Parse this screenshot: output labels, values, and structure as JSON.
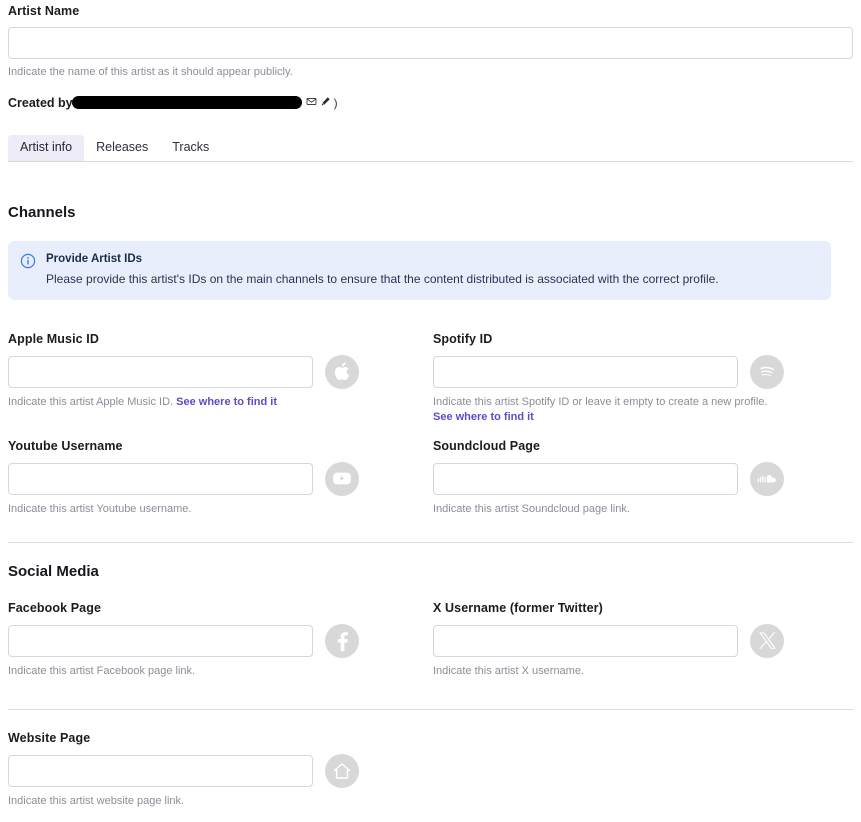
{
  "artist_name": {
    "label": "Artist Name",
    "value": "",
    "placeholder": "",
    "help": "Indicate the name of this artist as it should appear publicly."
  },
  "created_by": {
    "label": "Created by",
    "redacted_value": "",
    "mail_icon": "mail-icon",
    "pen_icon": "pen-icon",
    "trailing_paren": ")"
  },
  "tabs": [
    {
      "label": "Artist info",
      "active": true
    },
    {
      "label": "Releases",
      "active": false
    },
    {
      "label": "Tracks",
      "active": false
    }
  ],
  "channels": {
    "heading": "Channels",
    "banner": {
      "icon": "info-circle-icon",
      "title": "Provide Artist IDs",
      "body": "Please provide this artist's IDs on the main channels to ensure that the content distributed is associated with the correct profile.",
      "background_color": "#e8eefc",
      "icon_color": "#2f6fe0"
    },
    "fields": [
      {
        "label": "Apple Music ID",
        "value": "",
        "placeholder": "",
        "help": "Indicate this artist Apple Music ID.",
        "link": "See where to find it",
        "link_inline": true,
        "icon": "apple-music-icon"
      },
      {
        "label": "Spotify ID",
        "value": "",
        "placeholder": "",
        "help": "Indicate this artist Spotify ID or leave it empty to create a new profile.",
        "link": "See where to find it",
        "link_inline": false,
        "icon": "spotify-icon"
      },
      {
        "label": "Youtube Username",
        "value": "",
        "placeholder": "",
        "help": "Indicate this artist Youtube username.",
        "link": "",
        "icon": "youtube-icon"
      },
      {
        "label": "Soundcloud Page",
        "value": "",
        "placeholder": "",
        "help": "Indicate this artist Soundcloud page link.",
        "link": "",
        "icon": "soundcloud-icon"
      }
    ]
  },
  "social_media": {
    "heading": "Social Media",
    "fields": [
      {
        "label": "Facebook Page",
        "value": "",
        "placeholder": "",
        "help": "Indicate this artist Facebook page link.",
        "icon": "facebook-icon"
      },
      {
        "label": "X Username (former Twitter)",
        "value": "",
        "placeholder": "",
        "help": "Indicate this artist X username.",
        "icon": "x-twitter-icon"
      }
    ]
  },
  "website": {
    "fields": [
      {
        "label": "Website Page",
        "value": "",
        "placeholder": "",
        "help": "Indicate this artist website page link.",
        "icon": "home-icon"
      }
    ]
  },
  "colors": {
    "link": "#5b4ec2",
    "active_tab_bg": "#eeecf7",
    "banner_bg": "#e8eefc",
    "icon_circle": "#d8d8d8",
    "input_border": "#d5d7da"
  }
}
